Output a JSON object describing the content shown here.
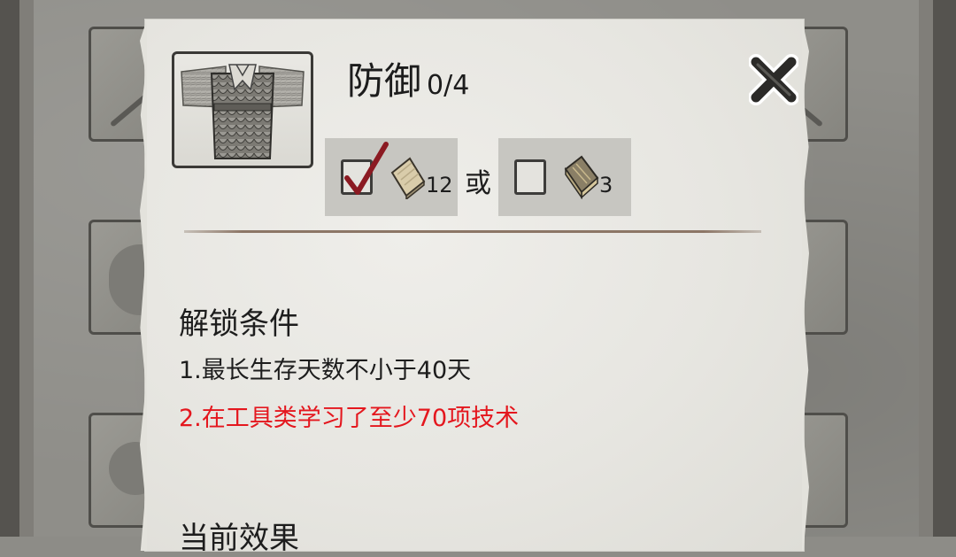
{
  "dialog": {
    "title": "防御",
    "progress": "0/4",
    "item_icon": "lamellar-armor-icon",
    "close_icon": "close-icon"
  },
  "cost": {
    "option_a": {
      "checked": true,
      "icon": "paper-scroll-icon",
      "quantity": "12"
    },
    "separator": "或",
    "option_b": {
      "checked": false,
      "icon": "bound-book-icon",
      "quantity": "3"
    }
  },
  "unlock": {
    "heading": "解锁条件",
    "conditions": [
      {
        "text": "1.最长生存天数不小于40天",
        "met": true
      },
      {
        "text": "2.在工具类学习了至少70项技术",
        "met": false
      }
    ]
  },
  "effect": {
    "heading": "当前效果"
  },
  "colors": {
    "condition_met": "#1d1d1d",
    "condition_unmet": "#e4171e",
    "check_red": "#8b1a22"
  }
}
